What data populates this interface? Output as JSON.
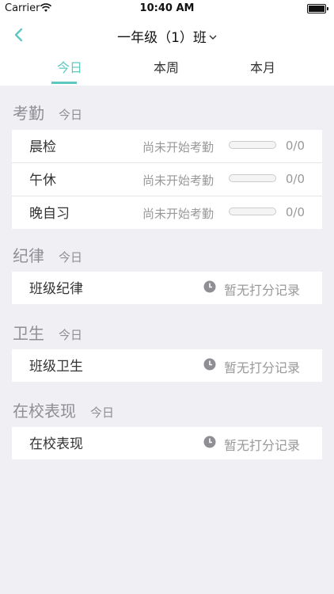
{
  "status_bar": {
    "carrier": "Carrier",
    "time": "10:40 AM"
  },
  "nav": {
    "title": "一年级（1）班"
  },
  "tabs": [
    {
      "label": "今日",
      "active": true
    },
    {
      "label": "本周",
      "active": false
    },
    {
      "label": "本月",
      "active": false
    }
  ],
  "attendance": {
    "title": "考勤",
    "subtitle": "今日",
    "rows": [
      {
        "label": "晨检",
        "status": "尚未开始考勤",
        "count": "0/0",
        "progress": 0
      },
      {
        "label": "午休",
        "status": "尚未开始考勤",
        "count": "0/0",
        "progress": 0
      },
      {
        "label": "晚自习",
        "status": "尚未开始考勤",
        "count": "0/0",
        "progress": 0
      }
    ]
  },
  "discipline": {
    "title": "纪律",
    "subtitle": "今日",
    "rows": [
      {
        "label": "班级纪律",
        "status": "暂无打分记录"
      }
    ]
  },
  "hygiene": {
    "title": "卫生",
    "subtitle": "今日",
    "rows": [
      {
        "label": "班级卫生",
        "status": "暂无打分记录"
      }
    ]
  },
  "performance": {
    "title": "在校表现",
    "subtitle": "今日",
    "rows": [
      {
        "label": "在校表现",
        "status": "暂无打分记录"
      }
    ]
  },
  "colors": {
    "accent": "#5bc9c0",
    "background": "#efeff4",
    "muted_text": "#999999"
  },
  "icons": {
    "back": "chevron-left-icon",
    "title_dropdown": "chevron-down-icon",
    "no_record": "clock-icon"
  }
}
